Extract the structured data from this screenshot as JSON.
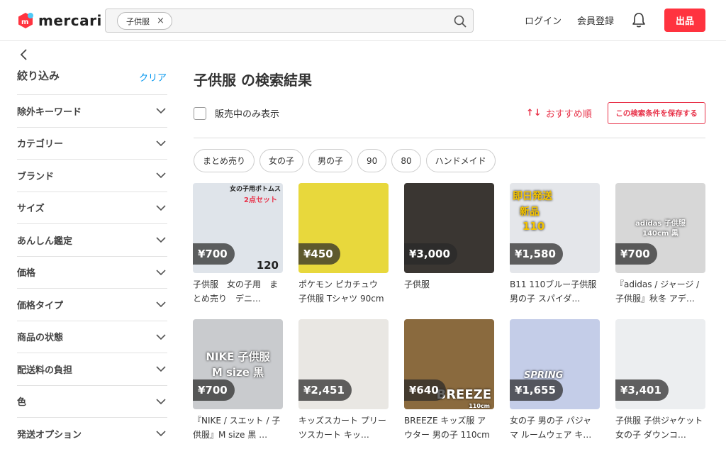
{
  "header": {
    "logo_text": "mercari",
    "search_chip": "子供服",
    "chip_close": "×",
    "login": "ログイン",
    "signup": "会員登録",
    "sell": "出品"
  },
  "sidebar": {
    "title": "絞り込み",
    "clear": "クリア",
    "items": [
      {
        "label": "除外キーワード"
      },
      {
        "label": "カテゴリー"
      },
      {
        "label": "ブランド"
      },
      {
        "label": "サイズ"
      },
      {
        "label": "あんしん鑑定"
      },
      {
        "label": "価格"
      },
      {
        "label": "価格タイプ"
      },
      {
        "label": "商品の状態"
      },
      {
        "label": "配送料の負担"
      },
      {
        "label": "色"
      },
      {
        "label": "発送オプション"
      }
    ]
  },
  "main": {
    "title": "子供服 の検索結果",
    "on_sale_label": "販売中のみ表示",
    "sort_icon": "↑↓",
    "sort_label": "おすすめ順",
    "save_search": "この検索条件を保存する",
    "tags": [
      "まとめ売り",
      "女の子",
      "男の子",
      "90",
      "80",
      "ハンドメイド"
    ]
  },
  "items": [
    {
      "price": "¥700",
      "title": "子供服　女の子用　まとめ売り　デニ…",
      "bg": "#dfe4ea",
      "overlay1": "女の子用ボトムス",
      "overlay2": "2点セット",
      "overlay3": "120"
    },
    {
      "price": "¥450",
      "title": "ポケモン ピカチュウ 子供服 Tシャツ 90cm",
      "bg": "#e8d83c",
      "overlay1": "",
      "overlay2": "",
      "overlay3": ""
    },
    {
      "price": "¥3,000",
      "title": "子供服",
      "bg": "#3a3632",
      "overlay1": "",
      "overlay2": "",
      "overlay3": ""
    },
    {
      "price": "¥1,580",
      "title": "B11 110ブルー子供服 男の子 スパイダ…",
      "bg": "#e4e6ea",
      "overlay1": "即日発送",
      "overlay2": "新品",
      "overlay3": "110"
    },
    {
      "price": "¥700",
      "title": "『adidas / ジャージ / 子供服』秋冬 アデ…",
      "bg": "#d7d7d7",
      "overlay1": "adidas 子供服",
      "overlay2": "140cm 黒",
      "overlay3": ""
    },
    {
      "price": "¥700",
      "title": "『NIKE / スエット / 子供服』M size 黒 …",
      "bg": "#c9cbce",
      "overlay1": "NIKE 子供服",
      "overlay2": "M size 黒",
      "overlay3": ""
    },
    {
      "price": "¥2,451",
      "title": "キッズスカート プリーツスカート キッ…",
      "bg": "#e9e7e3",
      "overlay1": "",
      "overlay2": "",
      "overlay3": ""
    },
    {
      "price": "¥640",
      "title": "BREEZE キッズ服 アウター 男の子 110cm",
      "bg": "#8a6a3e",
      "overlay1": "BREEZE",
      "overlay2": "",
      "overlay3": "110cm"
    },
    {
      "price": "¥1,655",
      "title": "女の子 男の子 パジャマ ルームウェア キ…",
      "bg": "#c4cde8",
      "overlay1": "SPRING",
      "overlay2": "",
      "overlay3": ""
    },
    {
      "price": "¥3,401",
      "title": "子供服 子供ジャケット 女の子 ダウンコ…",
      "bg": "#eceef0",
      "overlay1": "",
      "overlay2": "",
      "overlay3": ""
    }
  ],
  "colors": {
    "accent": "#ff333f",
    "link": "#0095ee",
    "sort": "#e8334a"
  }
}
